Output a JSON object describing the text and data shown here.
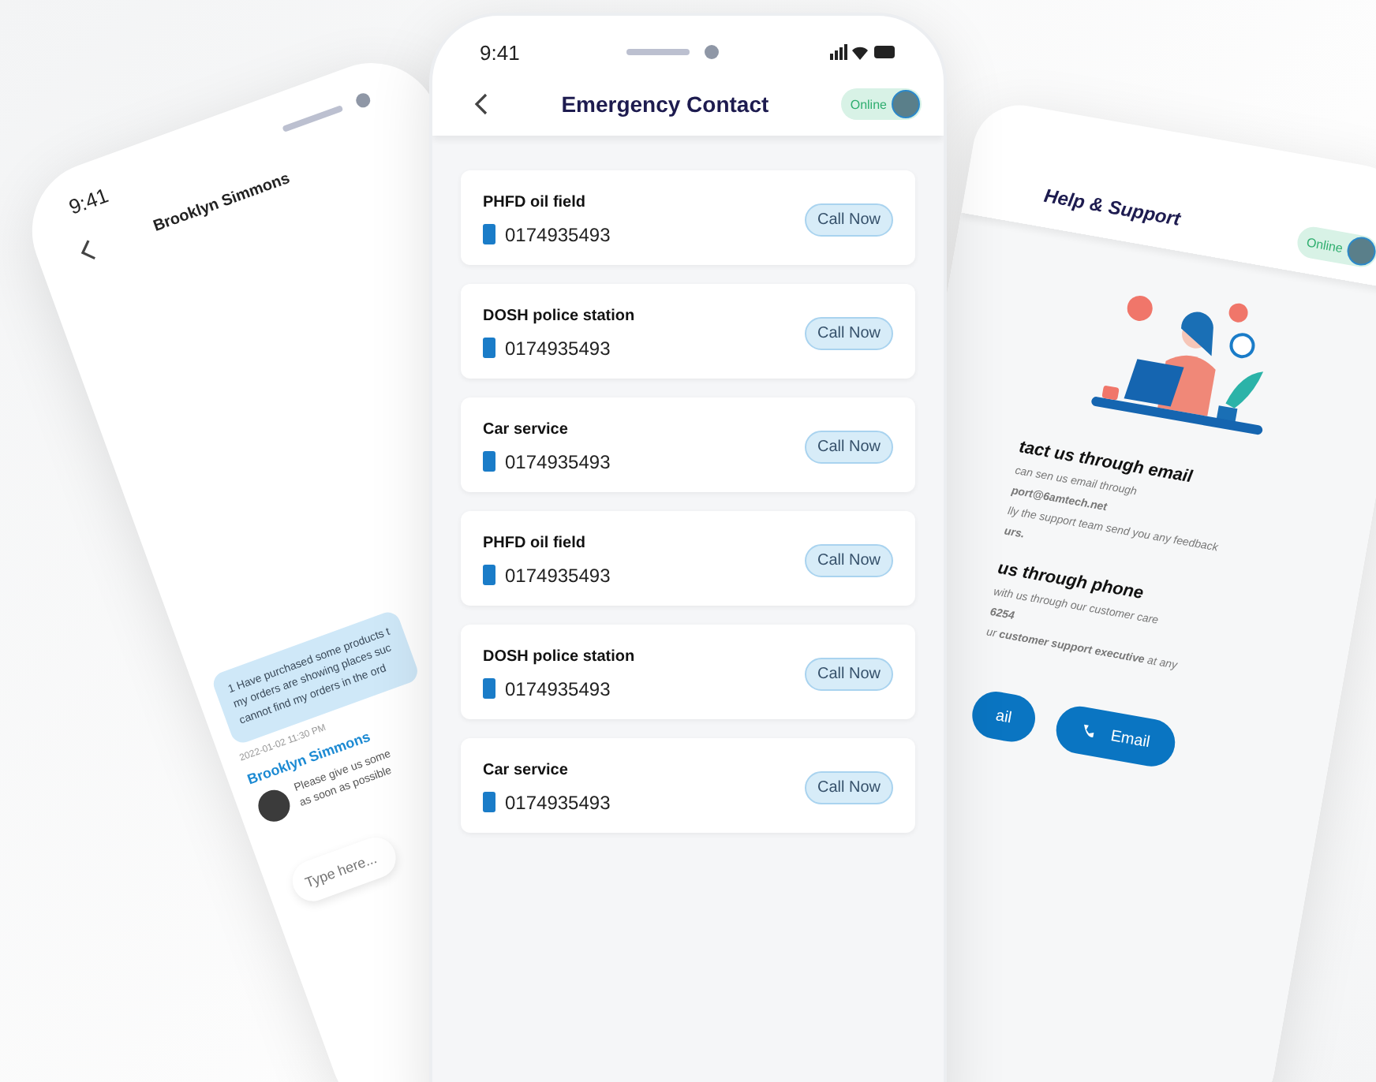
{
  "left_phone": {
    "time": "9:41",
    "title": "Brooklyn Simmons",
    "sent_message": {
      "lines": [
        "1 Have purchased some products t",
        "my orders are showing places suc",
        "cannot find my orders in the ord"
      ]
    },
    "timestamp": "2022-01-02 11:30 PM",
    "reply": {
      "sender": "Brooklyn Simmons",
      "lines": [
        "Please give us some",
        "as soon as possible"
      ]
    },
    "input": {
      "placeholder": "Type here..."
    }
  },
  "center_phone": {
    "time": "9:41",
    "title": "Emergency Contact",
    "status": "Online",
    "contacts": [
      {
        "name": "PHFD oil field",
        "phone": "0174935493",
        "action": "Call Now"
      },
      {
        "name": "DOSH police station",
        "phone": "0174935493",
        "action": "Call Now"
      },
      {
        "name": "Car service",
        "phone": "0174935493",
        "action": "Call Now"
      },
      {
        "name": "PHFD oil field",
        "phone": "0174935493",
        "action": "Call Now"
      },
      {
        "name": "DOSH police station",
        "phone": "0174935493",
        "action": "Call Now"
      },
      {
        "name": "Car service",
        "phone": "0174935493",
        "action": "Call Now"
      }
    ]
  },
  "right_phone": {
    "title": "Help & Support",
    "status": "Online",
    "sections": [
      {
        "heading": "tact us through email",
        "lines": [
          "can sen us email through",
          "**port@6amtech.net**",
          "lly the support team send you any feedback",
          "**urs.**"
        ]
      },
      {
        "heading": "us through phone",
        "lines": [
          "with us through our customer care",
          "**6254**",
          "ur **customer support executive** at any"
        ]
      }
    ],
    "buttons": [
      {
        "label": "ail",
        "kind": "partial"
      },
      {
        "label": "Email",
        "kind": "phone"
      }
    ]
  }
}
